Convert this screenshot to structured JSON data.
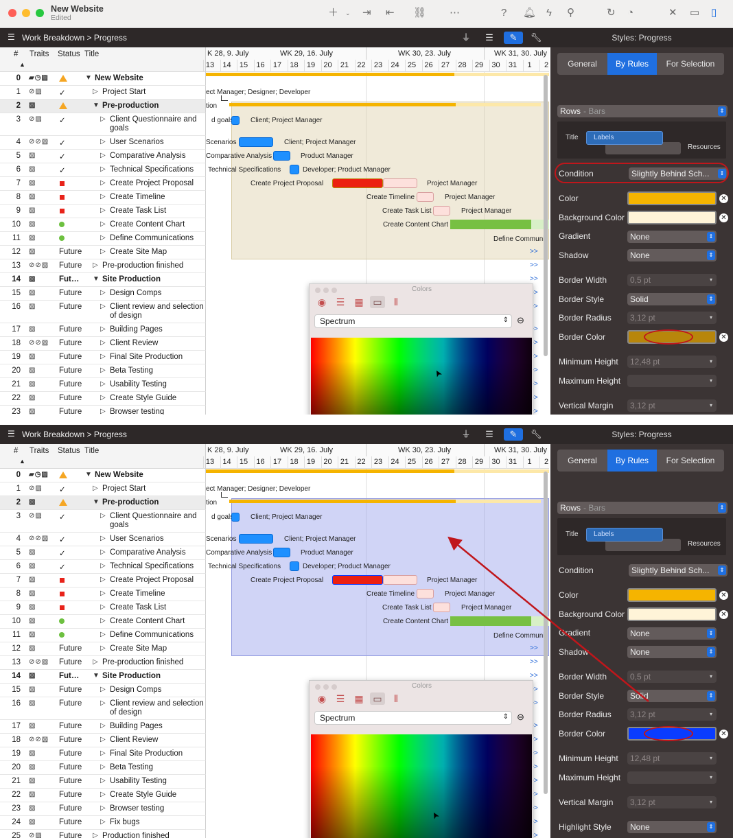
{
  "window": {
    "title": "New Website",
    "subtitle": "Edited"
  },
  "breadcrumb": {
    "root": "Work Breakdown",
    "sep": ">",
    "current": "Progress"
  },
  "inspector": {
    "styles_label": "Styles: Progress",
    "tabs": [
      "General",
      "By Rules",
      "For Selection"
    ],
    "active_tab": "By Rules"
  },
  "columns": {
    "num": "#",
    "traits": "Traits",
    "status": "Status",
    "title": "Title"
  },
  "gantt_header": {
    "weeks": [
      "K 28, 9. July",
      "WK 29, 16. July",
      "WK 30, 23. July",
      "WK 31, 30. July"
    ],
    "days": [
      "13",
      "14",
      "15",
      "16",
      "17",
      "18",
      "19",
      "20",
      "21",
      "22",
      "23",
      "24",
      "25",
      "26",
      "27",
      "28",
      "29",
      "30",
      "31",
      "1",
      "2"
    ]
  },
  "rows": [
    {
      "n": "0",
      "traits": "▰◷▨",
      "status": "tri",
      "title": "New Website",
      "bold": true,
      "indent": 0,
      "disc": "▼"
    },
    {
      "n": "1",
      "traits": "⊘▨",
      "status": "✓",
      "title": "Project Start",
      "indent": 1,
      "disc": "▷"
    },
    {
      "n": "2",
      "traits": "▨",
      "status": "tri",
      "title": "Pre-production",
      "bold": true,
      "indent": 1,
      "disc": "▼"
    },
    {
      "n": "3",
      "traits": "⊘▨",
      "status": "✓",
      "title": "Client Questionnaire and goals",
      "indent": 2,
      "disc": "▷",
      "tall": true
    },
    {
      "n": "4",
      "traits": "⊘⊘▨",
      "status": "✓",
      "title": "User Scenarios",
      "indent": 2,
      "disc": "▷"
    },
    {
      "n": "5",
      "traits": "▨",
      "status": "✓",
      "title": "Comparative Analysis",
      "indent": 2,
      "disc": "▷"
    },
    {
      "n": "6",
      "traits": "▨",
      "status": "✓",
      "title": "Technical Specifications",
      "indent": 2,
      "disc": "▷"
    },
    {
      "n": "7",
      "traits": "▨",
      "status": "sq",
      "title": "Create Project Proposal",
      "indent": 2,
      "disc": "▷"
    },
    {
      "n": "8",
      "traits": "▨",
      "status": "sq",
      "title": "Create Timeline",
      "indent": 2,
      "disc": "▷"
    },
    {
      "n": "9",
      "traits": "▨",
      "status": "sq",
      "title": "Create Task List",
      "indent": 2,
      "disc": "▷"
    },
    {
      "n": "10",
      "traits": "▨",
      "status": "dot",
      "title": "Create Content Chart",
      "indent": 2,
      "disc": "▷"
    },
    {
      "n": "11",
      "traits": "▨",
      "status": "dot",
      "title": "Define Communications",
      "indent": 2,
      "disc": "▷"
    },
    {
      "n": "12",
      "traits": "▨",
      "status": "Future",
      "title": "Create Site Map",
      "indent": 2,
      "disc": "▷"
    },
    {
      "n": "13",
      "traits": "⊘⊘▨",
      "status": "Future",
      "title": "Pre-production finished",
      "indent": 1,
      "disc": "▷"
    },
    {
      "n": "14",
      "traits": "▨",
      "status": "Fut…",
      "title": "Site Production",
      "bold": true,
      "indent": 1,
      "disc": "▼"
    },
    {
      "n": "15",
      "traits": "▨",
      "status": "Future",
      "title": "Design Comps",
      "indent": 2,
      "disc": "▷"
    },
    {
      "n": "16",
      "traits": "▨",
      "status": "Future",
      "title": "Client review and selection of design",
      "indent": 2,
      "disc": "▷",
      "tall": true
    },
    {
      "n": "17",
      "traits": "▨",
      "status": "Future",
      "title": "Building Pages",
      "indent": 2,
      "disc": "▷"
    },
    {
      "n": "18",
      "traits": "⊘⊘▨",
      "status": "Future",
      "title": "Client Review",
      "indent": 2,
      "disc": "▷"
    },
    {
      "n": "19",
      "traits": "▨",
      "status": "Future",
      "title": "Final Site Production",
      "indent": 2,
      "disc": "▷"
    },
    {
      "n": "20",
      "traits": "▨",
      "status": "Future",
      "title": "Beta Testing",
      "indent": 2,
      "disc": "▷"
    },
    {
      "n": "21",
      "traits": "▨",
      "status": "Future",
      "title": "Usability Testing",
      "indent": 2,
      "disc": "▷"
    },
    {
      "n": "22",
      "traits": "▨",
      "status": "Future",
      "title": "Create Style Guide",
      "indent": 2,
      "disc": "▷"
    },
    {
      "n": "23",
      "traits": "▨",
      "status": "Future",
      "title": "Browser testing",
      "indent": 2,
      "disc": "▷"
    },
    {
      "n": "24",
      "traits": "▨",
      "status": "Future",
      "title": "Fix bugs",
      "indent": 2,
      "disc": "▷"
    },
    {
      "n": "25",
      "traits": "⊘▨",
      "status": "Future",
      "title": "Production finished",
      "indent": 1,
      "disc": "▷"
    }
  ],
  "gantt_labels": {
    "r1": "ect Manager; Designer; Developer",
    "r2": "tion",
    "r3a": "d goals",
    "r3b": "Client; Project Manager",
    "r4a": "Scenarios",
    "r4b": "Client; Project Manager",
    "r5a": "Comparative Analysis",
    "r5b": "Product Manager",
    "r6a": "Technical Specifications",
    "r6b": "Developer; Product Manager",
    "r7a": "Create Project Proposal",
    "r7b": "Project Manager",
    "r8a": "Create Timeline",
    "r8b": "Project Manager",
    "r9a": "Create Task List",
    "r9b": "Project Manager",
    "r10a": "Create Content Chart",
    "r11a": "Define Communi",
    "more": ">>"
  },
  "props": {
    "rows_popup": "Rows",
    "rows_popup_sub": "- Bars",
    "title_lbl": "Title",
    "labels_lbl": "Labels",
    "resources_lbl": "Resources",
    "condition_lbl": "Condition",
    "condition_val": "Slightly Behind Sch...",
    "color_lbl": "Color",
    "bgcolor_lbl": "Background Color",
    "gradient_lbl": "Gradient",
    "gradient_val": "None",
    "shadow_lbl": "Shadow",
    "shadow_val": "None",
    "bwidth_lbl": "Border Width",
    "bwidth_val": "0,5 pt",
    "bstyle_lbl": "Border Style",
    "bstyle_val": "Solid",
    "bradius_lbl": "Border Radius",
    "bradius_val": "3,12 pt",
    "bcolor_lbl": "Border Color",
    "minh_lbl": "Minimum Height",
    "minh_val": "12,48 pt",
    "maxh_lbl": "Maximum Height",
    "vmargin_lbl": "Vertical Margin",
    "vmargin_val": "3,12 pt",
    "highlight_lbl": "Highlight Style",
    "highlight_val": "None"
  },
  "colors_panel": {
    "title": "Colors",
    "mode": "Spectrum"
  },
  "palette": {
    "accent": "#1f6fe0",
    "bar_yellow": "#f5b400",
    "border_before": "#b8860b",
    "border_after": "#0a3cff",
    "annotation_red": "#c0161b"
  }
}
